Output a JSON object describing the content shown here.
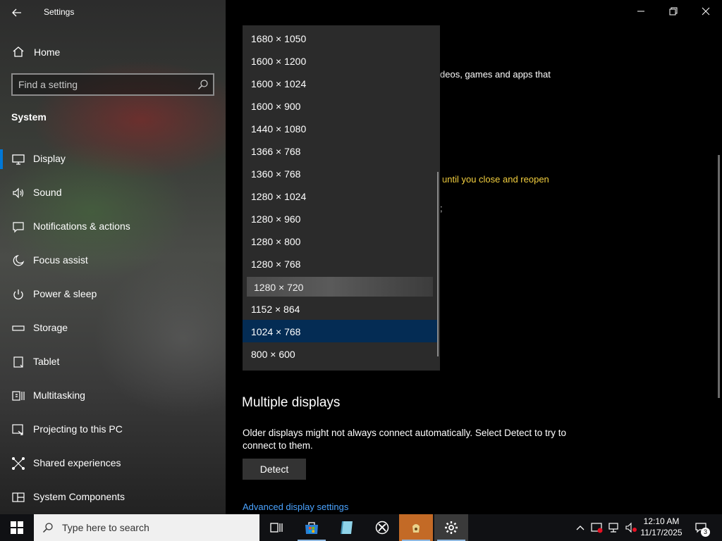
{
  "window": {
    "title": "Settings",
    "controls": [
      "minimize-icon",
      "restore-icon",
      "close-icon"
    ]
  },
  "sidebar": {
    "home_label": "Home",
    "search_placeholder": "Find a setting",
    "section_title": "System",
    "items": [
      {
        "label": "Display",
        "icon": "monitor-icon",
        "active": true
      },
      {
        "label": "Sound",
        "icon": "speaker-icon"
      },
      {
        "label": "Notifications & actions",
        "icon": "message-icon"
      },
      {
        "label": "Focus assist",
        "icon": "moon-icon"
      },
      {
        "label": "Power & sleep",
        "icon": "power-icon"
      },
      {
        "label": "Storage",
        "icon": "storage-icon"
      },
      {
        "label": "Tablet",
        "icon": "tablet-icon"
      },
      {
        "label": "Multitasking",
        "icon": "multitasking-icon"
      },
      {
        "label": "Projecting to this PC",
        "icon": "projector-icon"
      },
      {
        "label": "Shared experiences",
        "icon": "share-icon"
      },
      {
        "label": "System Components",
        "icon": "components-icon"
      }
    ]
  },
  "main": {
    "partial_text_1": "deos, games and apps that",
    "partial_text_2": "until you close and reopen",
    "partial_text_3": ";",
    "multiple_displays_heading": "Multiple displays",
    "multiple_displays_desc": "Older displays might not always connect automatically. Select Detect to try to connect to them.",
    "detect_label": "Detect",
    "advanced_link": "Advanced display settings"
  },
  "resolution_dropdown": {
    "options": [
      "1680 × 1050",
      "1600 × 1200",
      "1600 × 1024",
      "1600 × 900",
      "1440 × 1080",
      "1366 × 768",
      "1360 × 768",
      "1280 × 1024",
      "1280 × 960",
      "1280 × 800",
      "1280 × 768",
      "1280 × 720",
      "1152 × 864",
      "1024 × 768",
      "800 × 600"
    ],
    "hovered": "1280 × 720",
    "selected": "1024 × 768"
  },
  "taskbar": {
    "search_placeholder": "Type here to search",
    "apps": [
      "task-view-icon",
      "store-icon",
      "app-icon",
      "xbox-icon",
      "game-app-icon",
      "settings-gear-icon"
    ],
    "time": "12:10 AM",
    "date": "11/17/2025",
    "notification_count": "3"
  },
  "colors": {
    "accent": "#0078d7",
    "selected_option": "#042c54",
    "warning_text": "#f4d03f",
    "link": "#4aa3ff"
  }
}
